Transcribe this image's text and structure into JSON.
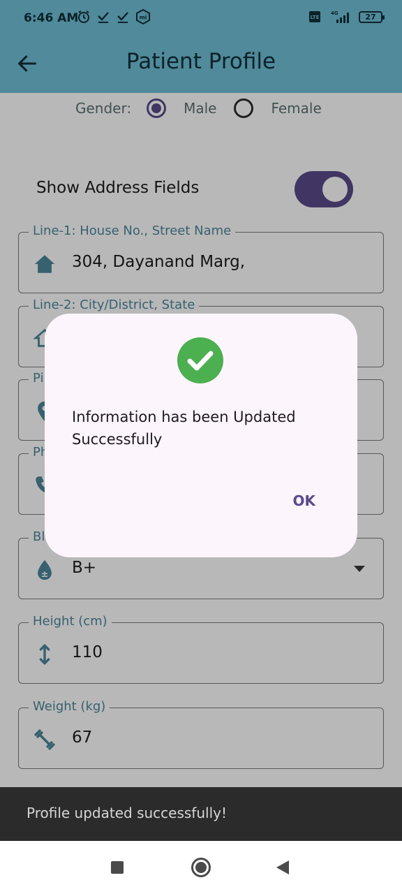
{
  "status_bar": {
    "time": "6:46 AM",
    "battery": "27",
    "icons": [
      "alarm-icon",
      "check-icon",
      "check-icon",
      "mi-icon",
      "volte-icon",
      "signal-4g-icon",
      "battery-icon"
    ]
  },
  "app_bar": {
    "title": "Patient Profile",
    "back_icon": "arrow-back-icon"
  },
  "form": {
    "gender": {
      "label": "Gender:",
      "options": [
        "Male",
        "Female"
      ],
      "selected": "Male"
    },
    "address_toggle": {
      "label": "Show Address Fields",
      "on": true
    },
    "fields": [
      {
        "label": "Line-1: House No., Street Name",
        "value": "304, Dayanand Marg,",
        "icon": "home-icon"
      },
      {
        "label": "Line-2: City/District, State",
        "value": "",
        "icon": "home-outline-icon"
      },
      {
        "label": "Pi",
        "value": "",
        "icon": "location-pin-icon"
      },
      {
        "label": "Ph",
        "value": "",
        "icon": "phone-icon"
      },
      {
        "label": "Bl",
        "value": "B+",
        "icon": "blood-drop-icon"
      },
      {
        "label": "Height (cm)",
        "value": "110",
        "icon": "height-arrows-icon"
      },
      {
        "label": "Weight (kg)",
        "value": "67",
        "icon": "dumbbell-icon"
      }
    ]
  },
  "dialog": {
    "icon": "check-circle-icon",
    "message": "Information has been Updated Successfully",
    "ok_label": "OK"
  },
  "snackbar": {
    "text": "Profile updated successfully!"
  },
  "nav_bar": {
    "icons": [
      "recents-icon",
      "home-icon",
      "back-icon"
    ]
  },
  "colors": {
    "app_bar": "#508a9b",
    "accent": "#5b4a8a",
    "field_label": "#4d8799",
    "dialog_bg": "#fcf5fb",
    "success": "#4caf50",
    "snackbar_bg": "#2b2b2b"
  }
}
